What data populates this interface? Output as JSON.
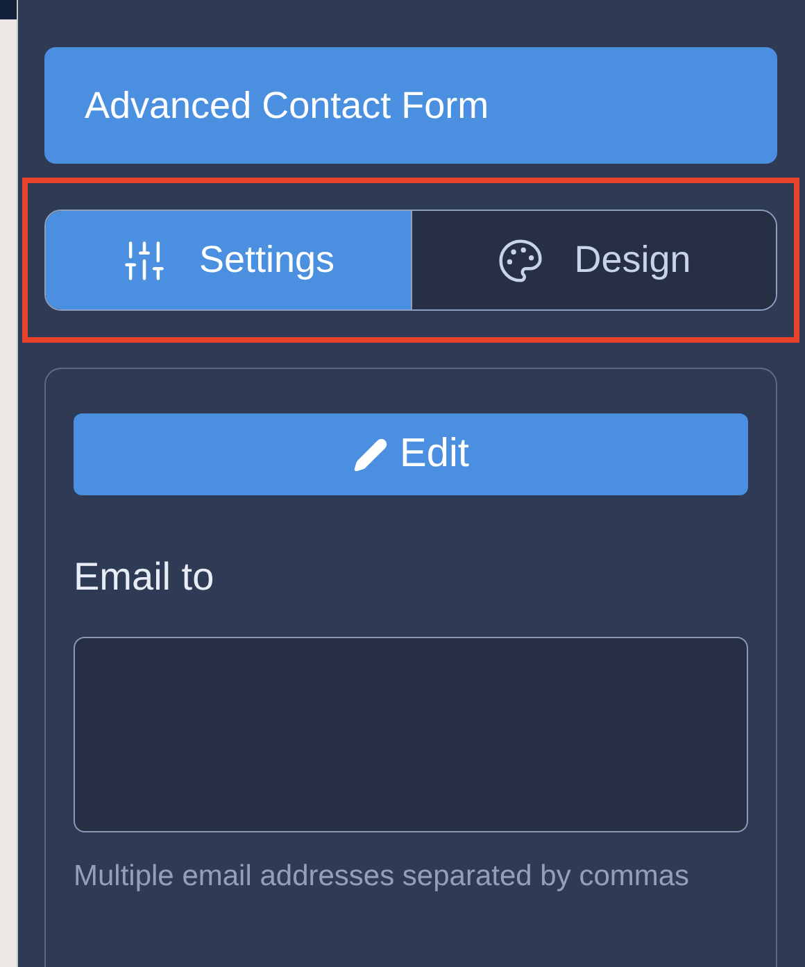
{
  "title_button": "Advanced Contact Form",
  "tabs_highlighted": true,
  "tabs": [
    {
      "label": "Settings",
      "kind": "settings",
      "selected": true
    },
    {
      "label": "Design",
      "kind": "design",
      "selected": false
    }
  ],
  "edit_button": "Edit",
  "email_field": {
    "label": "Email to",
    "help": "Multiple email addresses separated by commas"
  }
}
